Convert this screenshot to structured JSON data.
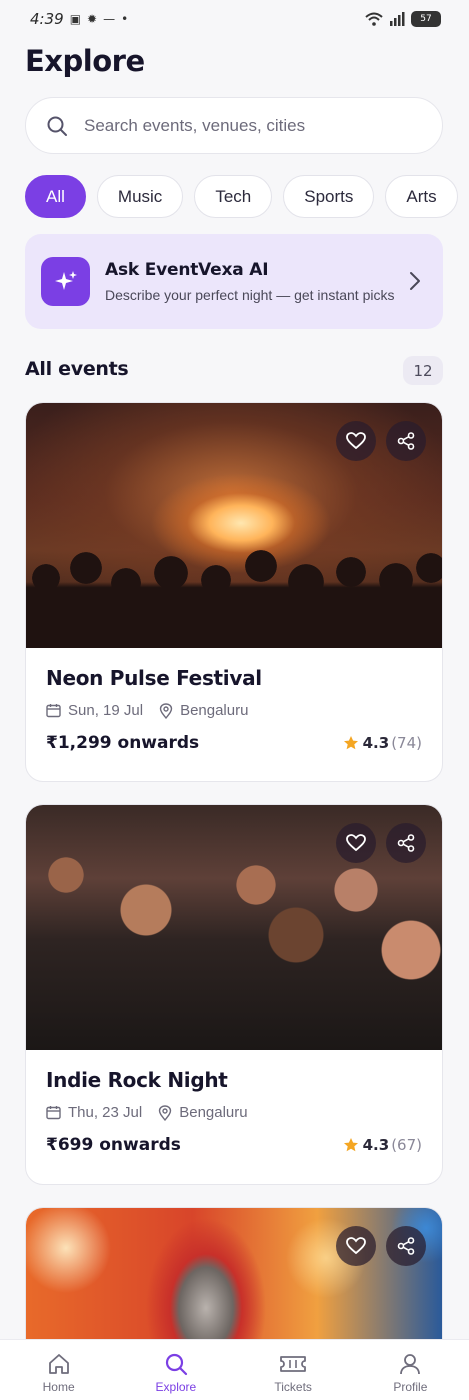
{
  "status_bar": {
    "time": "4:39",
    "battery": "57"
  },
  "header": {
    "title": "Explore"
  },
  "search": {
    "placeholder": "Search events, venues, cities"
  },
  "chips": [
    "All",
    "Music",
    "Tech",
    "Sports",
    "Arts"
  ],
  "ai_banner": {
    "title": "Ask EventVexa AI",
    "subtitle": "Describe your perfect night — get instant picks"
  },
  "events_section": {
    "title": "All events",
    "count": "12"
  },
  "events": [
    {
      "title": "Neon Pulse Festival",
      "date": "Sun, 19 Jul",
      "city": "Bengaluru",
      "price": "₹1,299 onwards",
      "rating": "4.3",
      "reviews": "(74)"
    },
    {
      "title": "Indie Rock Night",
      "date": "Thu, 23 Jul",
      "city": "Bengaluru",
      "price": "₹699 onwards",
      "rating": "4.3",
      "reviews": "(67)"
    }
  ],
  "bottom_nav": [
    {
      "label": "Home",
      "icon": "home-icon"
    },
    {
      "label": "Explore",
      "icon": "search-icon",
      "active": true
    },
    {
      "label": "Tickets",
      "icon": "ticket-icon"
    },
    {
      "label": "Profile",
      "icon": "user-icon"
    }
  ],
  "colors": {
    "accent": "#7b3fe4",
    "banner_bg": "#ece6fb",
    "star": "#f4a623"
  }
}
